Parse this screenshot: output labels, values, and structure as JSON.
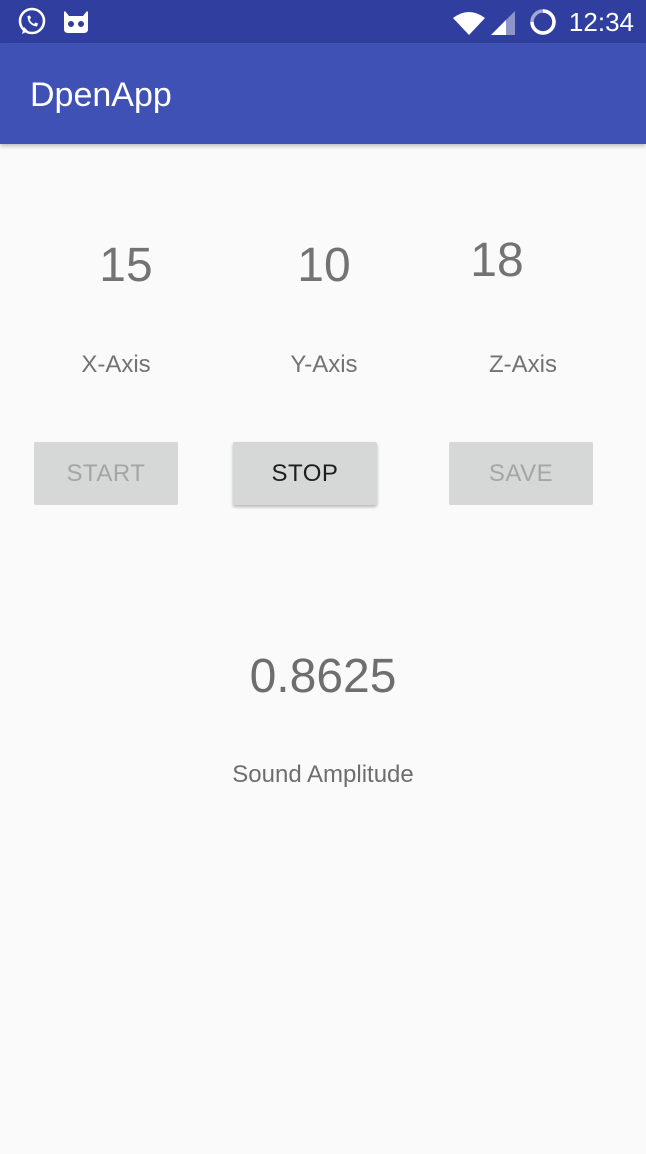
{
  "status_bar": {
    "time": "12:34",
    "icons": [
      "whatsapp-icon",
      "android-icon",
      "wifi-icon",
      "signal-icon",
      "sync-icon"
    ]
  },
  "app_bar": {
    "title": "DpenApp",
    "color": "#3f51b5",
    "status_color": "#303f9f"
  },
  "axes": [
    {
      "value": "15",
      "label": "X-Axis"
    },
    {
      "value": "10",
      "label": "Y-Axis"
    },
    {
      "value": "18",
      "label": "Z-Axis"
    }
  ],
  "buttons": {
    "start": {
      "label": "START",
      "enabled": false
    },
    "stop": {
      "label": "STOP",
      "enabled": true
    },
    "save": {
      "label": "SAVE",
      "enabled": false
    }
  },
  "sound": {
    "value": "0.8625",
    "label": "Sound Amplitude"
  }
}
